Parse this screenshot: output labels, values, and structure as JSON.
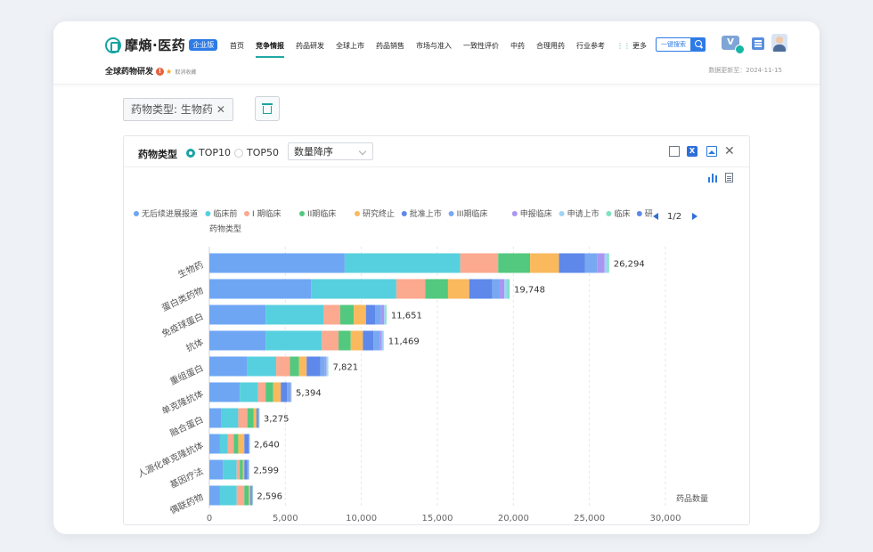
{
  "nav": {
    "logo": "摩熵·医药",
    "badge": "企业版",
    "items": [
      "首页",
      "竞争情报",
      "药品研发",
      "全球上市",
      "药品销售",
      "市场与准入",
      "一致性评价",
      "中药",
      "合理用药",
      "行业参考",
      "更多"
    ],
    "active": "竞争情报",
    "search_label": "一键搜索"
  },
  "page": {
    "title": "全球药物研发",
    "fav": "取消收藏",
    "updated": "数据更新至：2024-11-15"
  },
  "filter": {
    "tag": "药物类型: 生物药",
    "close": "✕"
  },
  "panel": {
    "title": "药物类型",
    "radio1": "TOP10",
    "radio2": "TOP50",
    "sort": "数量降序"
  },
  "legend": {
    "items": [
      "无后续进展报道",
      "临床前",
      "I 期临床",
      "II期临床",
      "研究终止",
      "批准上市",
      "III期临床",
      "申报临床",
      "申请上市",
      "临床",
      "研"
    ],
    "page": "1/2"
  },
  "chart_data": {
    "type": "bar",
    "orientation": "horizontal",
    "stacked": true,
    "ylabel": "药物类型",
    "xlabel": "药品数量",
    "xlim": [
      0,
      30000
    ],
    "xticks": [
      0,
      5000,
      10000,
      15000,
      20000,
      25000,
      30000
    ],
    "xtick_labels": [
      "0",
      "5,000",
      "10,000",
      "15,000",
      "20,000",
      "25,000",
      "30,000"
    ],
    "categories": [
      "生物药",
      "蛋白类药物",
      "免疫球蛋白",
      "抗体",
      "重组蛋白",
      "单克隆抗体",
      "融合蛋白",
      "人源化单克隆抗体",
      "基因疗法",
      "偶联药物"
    ],
    "totals": [
      26294,
      19748,
      11651,
      11469,
      7821,
      5394,
      3275,
      2640,
      2599,
      2596
    ],
    "total_labels": [
      "26,294",
      "19,748",
      "11,651",
      "11,469",
      "7,821",
      "5,394",
      "3,275",
      "2,640",
      "2,599",
      "2,596"
    ],
    "grid": true,
    "legend_position": "top",
    "series": [
      {
        "name": "无后续进展报道",
        "color": "#6ea6f4",
        "values": [
          8900,
          6700,
          3700,
          3700,
          2500,
          2000,
          800,
          700,
          900,
          700
        ]
      },
      {
        "name": "临床前",
        "color": "#56d0de",
        "values": [
          7600,
          5600,
          3800,
          3700,
          1900,
          1200,
          1100,
          500,
          900,
          1100
        ]
      },
      {
        "name": "I 期临床",
        "color": "#fba98f",
        "values": [
          2500,
          1900,
          1100,
          1100,
          900,
          500,
          600,
          400,
          200,
          500
        ]
      },
      {
        "name": "II期临床",
        "color": "#52c97e",
        "values": [
          2100,
          1500,
          900,
          800,
          600,
          500,
          400,
          300,
          200,
          300
        ]
      },
      {
        "name": "研究终止",
        "color": "#f9b95c",
        "values": [
          1900,
          1400,
          800,
          800,
          500,
          500,
          200,
          400,
          100,
          100
        ]
      },
      {
        "name": "批准上市",
        "color": "#5e88ea",
        "values": [
          1700,
          1500,
          600,
          700,
          900,
          400,
          100,
          300,
          200,
          100
        ]
      },
      {
        "name": "III期临床",
        "color": "#79a8f2",
        "values": [
          800,
          500,
          400,
          400,
          300,
          200,
          50,
          20,
          50,
          20
        ]
      },
      {
        "name": "申报临床",
        "color": "#a996f0",
        "values": [
          500,
          300,
          200,
          150,
          100,
          60,
          15,
          10,
          40,
          10
        ]
      },
      {
        "name": "申请上市",
        "color": "#9fd4f5",
        "values": [
          200,
          200,
          100,
          80,
          80,
          20,
          5,
          5,
          5,
          5
        ]
      },
      {
        "name": "临床",
        "color": "#7fe0c2",
        "values": [
          94,
          148,
          51,
          39,
          41,
          14,
          5,
          5,
          4,
          1
        ]
      }
    ]
  }
}
